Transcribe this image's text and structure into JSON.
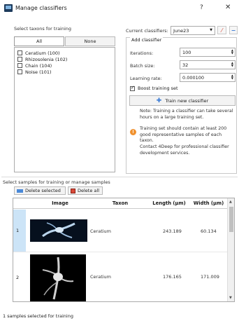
{
  "window": {
    "title": "Manage classifiers",
    "help": "?",
    "close": "✕"
  },
  "taxa_section": {
    "label": "Select taxons for training",
    "all_button": "All",
    "none_button": "None",
    "items": [
      {
        "label": "Ceratium (100)",
        "checked": false
      },
      {
        "label": "Rhizosolenia (102)",
        "checked": false
      },
      {
        "label": "Chain (104)",
        "checked": false
      },
      {
        "label": "Noise (101)",
        "checked": false
      }
    ]
  },
  "classifier": {
    "current_label": "Current classifiers:",
    "current_value": "June23"
  },
  "add_classifier": {
    "group_title": "Add classifier",
    "iterations_label": "Iterations:",
    "iterations_value": "100",
    "batch_label": "Batch size:",
    "batch_value": "32",
    "lr_label": "Learning rate:",
    "lr_value": "0.000100",
    "boost_label": "Boost training set",
    "boost_checked": true,
    "train_button": "Train new classifier",
    "note": "Note: Training a classifier can take several hours on a large training set.",
    "warning": "Training set should contain at least 200 good representative samples of each taxon.",
    "contact": "Contact 4Deep for professional classifier development services."
  },
  "samples_section": {
    "label": "Select samples for training or manage samples",
    "delete_selected": "Delete selected",
    "delete_all": "Delete all"
  },
  "table": {
    "headers": [
      "Image",
      "Taxon",
      "Length (µm)",
      "Width (µm)"
    ],
    "rows": [
      {
        "num": "1",
        "taxon": "Ceratium",
        "length": "243.189",
        "width": "60.134"
      },
      {
        "num": "2",
        "taxon": "Ceratium",
        "length": "176.165",
        "width": "171.009"
      }
    ]
  },
  "status": "1 samples selected for training",
  "colors": {
    "selected_row": "#cce4f7",
    "warning": "#f0912e",
    "train_icon": "#3a7bd5"
  }
}
